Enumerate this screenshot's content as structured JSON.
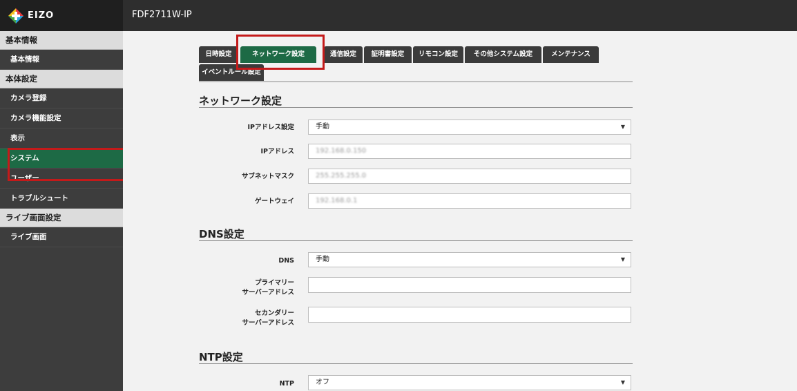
{
  "header": {
    "logo_text": "EIZO",
    "model": "FDF2711W-IP"
  },
  "sidebar": {
    "sections": [
      {
        "label": "基本情報",
        "items": [
          "基本情報"
        ]
      },
      {
        "label": "本体設定",
        "items": [
          "カメラ登録",
          "カメラ機能設定",
          "表示",
          "システム",
          "ユーザー",
          "トラブルシュート"
        ]
      },
      {
        "label": "ライブ画面設定",
        "items": [
          "ライブ画面"
        ]
      }
    ],
    "active_item": "システム"
  },
  "tabs": [
    "日時設定",
    "ネットワーク設定",
    "通信設定",
    "証明書設定",
    "リモコン設定",
    "その他システム設定",
    "メンテナンス",
    "イベントルール設定"
  ],
  "active_tab": "ネットワーク設定",
  "network": {
    "title": "ネットワーク設定",
    "ip_mode_label": "IPアドレス設定",
    "ip_mode_value": "手動",
    "ip_label": "IPアドレス",
    "ip_value": "192.168.0.150",
    "subnet_label": "サブネットマスク",
    "subnet_value": "255.255.255.0",
    "gateway_label": "ゲートウェイ",
    "gateway_value": "192.168.0.1"
  },
  "dns": {
    "title": "DNS設定",
    "mode_label": "DNS",
    "mode_value": "手動",
    "primary_label_1": "プライマリー",
    "primary_label_2": "サーバーアドレス",
    "primary_value": "",
    "secondary_label_1": "セカンダリー",
    "secondary_label_2": "サーバーアドレス",
    "secondary_value": ""
  },
  "ntp": {
    "title": "NTP設定",
    "mode_label": "NTP",
    "mode_value": "オフ"
  },
  "icons": {
    "dropdown": "chevron-down-icon",
    "logo": "eizo-logo-icon"
  }
}
